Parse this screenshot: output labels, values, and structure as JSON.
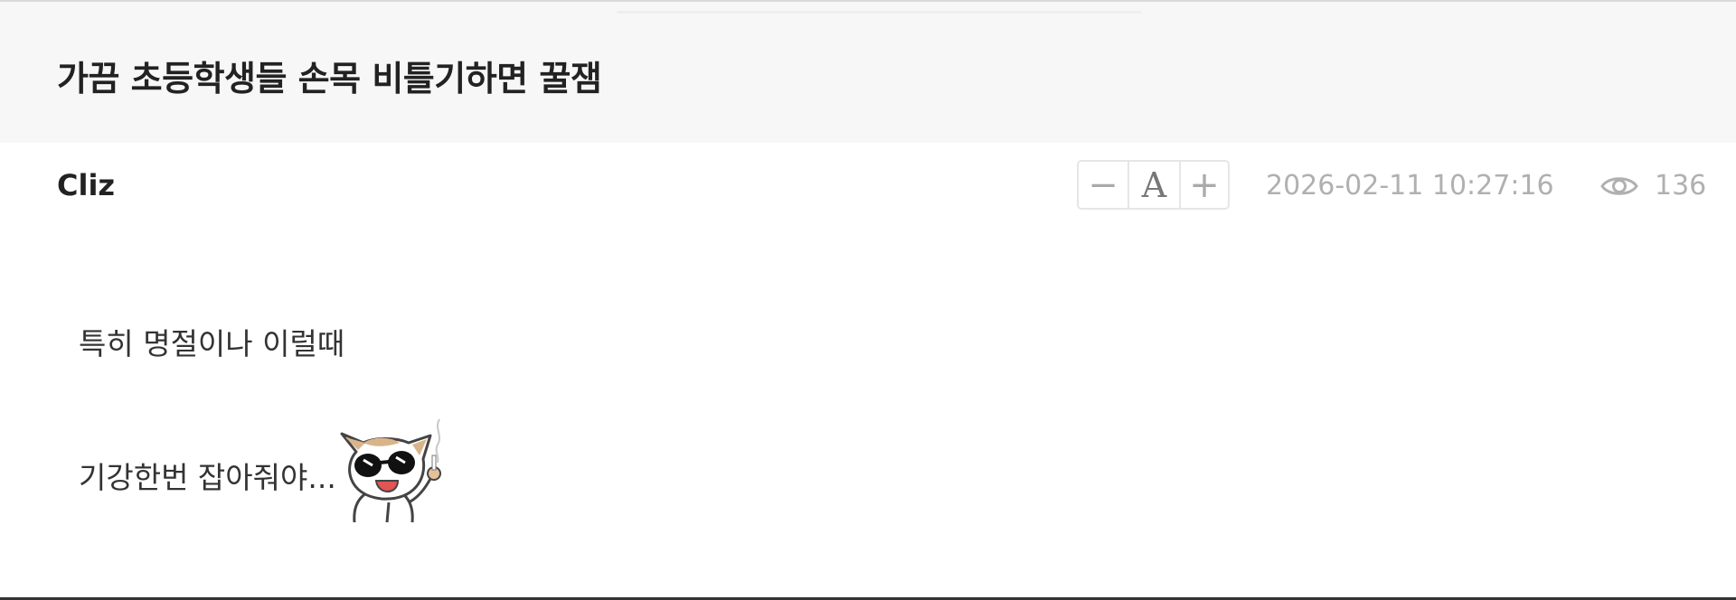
{
  "post": {
    "title": "가끔 초등학생들 손목 비틀기하면 꿀잼",
    "author": "Cliz",
    "datetime": "2026-02-11 10:27:16",
    "views": "136",
    "lines": [
      "특히 명절이나 이럴때",
      "기강한번 잡아줘야..."
    ]
  },
  "font_controls": {
    "decrease_label": "−",
    "font_label": "A",
    "increase_label": "+"
  },
  "icons": {
    "views": "eye-icon",
    "sticker": "cat-sunglasses-sticker"
  },
  "colors": {
    "title_bar_bg": "#f7f7f7",
    "muted_text": "#b0b0b0",
    "body_text": "#333333"
  }
}
